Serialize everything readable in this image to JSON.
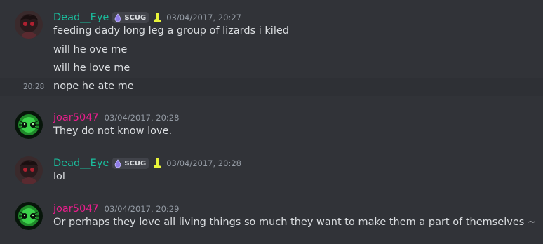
{
  "colors": {
    "background": "#313338",
    "hover_row": "#2e3035",
    "username_dead_eye": "#1abc9c",
    "username_joar": "#e91e8c",
    "timestamp": "#949ba4",
    "badge_bg": "#41434a",
    "text": "#dbdee1"
  },
  "messages": [
    {
      "author": "Dead__Eye",
      "avatar_icon": "dark-red-character-avatar-icon",
      "badge_icon": "purple-droplet-icon",
      "badge": "SCUG",
      "extra_icon": "yellow-leg-icon",
      "timestamp": "03/04/2017, 20:27",
      "lines": [
        "feeding dady long leg a group of lizards i kiled",
        "will he ove me",
        "will he love me",
        "nope he ate me"
      ],
      "hover_time": "20:28"
    },
    {
      "author": "joar5047",
      "avatar_icon": "green-eye-creature-avatar-icon",
      "timestamp": "03/04/2017, 20:28",
      "lines": [
        "They do not know love."
      ]
    },
    {
      "author": "Dead__Eye",
      "avatar_icon": "dark-red-character-avatar-icon",
      "badge_icon": "purple-droplet-icon",
      "badge": "SCUG",
      "extra_icon": "yellow-leg-icon",
      "timestamp": "03/04/2017, 20:28",
      "lines": [
        "lol"
      ]
    },
    {
      "author": "joar5047",
      "avatar_icon": "green-eye-creature-avatar-icon",
      "timestamp": "03/04/2017, 20:29",
      "lines": [
        "Or perhaps they love all living things so much they want to make them a part of themselves ~"
      ]
    }
  ]
}
